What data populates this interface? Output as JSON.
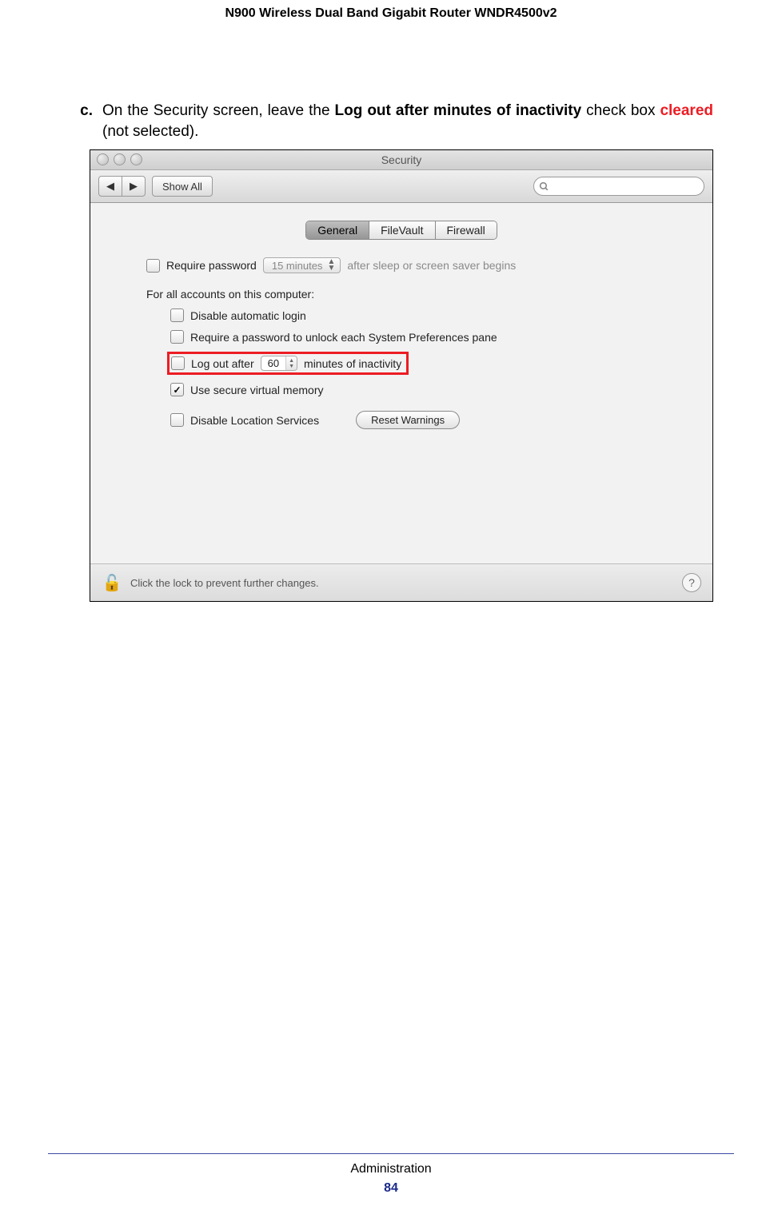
{
  "page": {
    "header_title": "N900 Wireless Dual Band Gigabit Router WNDR4500v2",
    "footer_category": "Administration",
    "footer_page": "84"
  },
  "instruction": {
    "marker": "c.",
    "text_before": "On the Security screen, leave the ",
    "bold_phrase": "Log out after minutes of inactivity",
    "text_mid": " check box ",
    "cleared_word": "cleared",
    "text_after": " (not selected)."
  },
  "window": {
    "title": "Security",
    "show_all": "Show All",
    "nav_back_glyph": "◀",
    "nav_fwd_glyph": "▶",
    "tabs": {
      "general": "General",
      "filevault": "FileVault",
      "firewall": "Firewall"
    },
    "require_password": {
      "label": "Require password",
      "popup_value": "15 minutes",
      "after_text": "after sleep or screen saver begins"
    },
    "all_accounts_label": "For all accounts on this computer:",
    "disable_auto_login": "Disable automatic login",
    "require_pw_pane": "Require a password to unlock each System Preferences pane",
    "logout": {
      "before": "Log out after",
      "value": "60",
      "after": "minutes of inactivity"
    },
    "secure_vm": "Use secure virtual memory",
    "disable_location": "Disable Location Services",
    "reset_warnings": "Reset Warnings",
    "lock_text": "Click the lock to prevent further changes.",
    "help_glyph": "?"
  }
}
